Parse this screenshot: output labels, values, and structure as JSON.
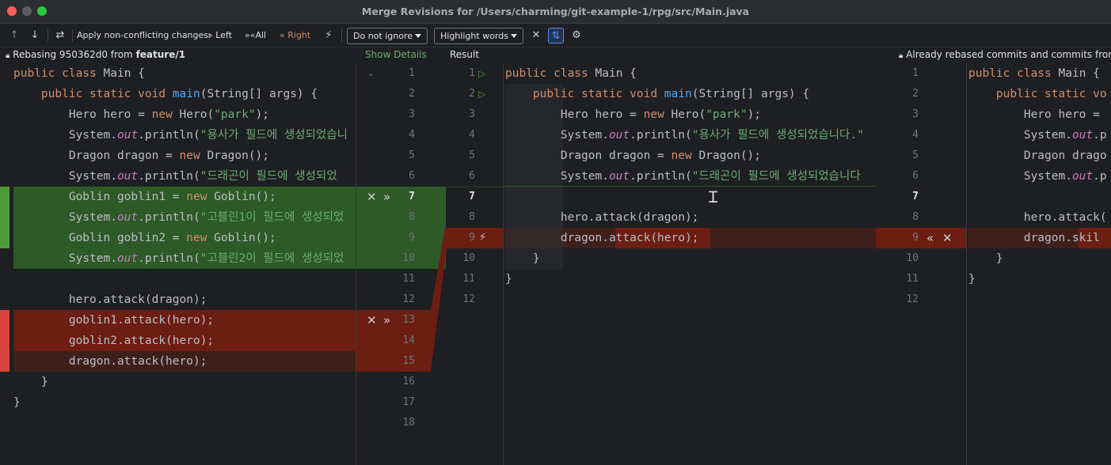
{
  "window": {
    "title": "Merge Revisions for /Users/charming/git-example-1/rpg/src/Main.java"
  },
  "toolbar": {
    "apply_label": "Apply non-conflicting changes:",
    "left_label": "Left",
    "all_label": "All",
    "right_label": "Right",
    "ignore_dropdown": "Do not ignore",
    "highlight_dropdown": "Highlight words"
  },
  "header": {
    "left_info": "Rebasing 950362d0 from",
    "left_branch": "feature/1",
    "show_details": "Show Details",
    "result": "Result",
    "right_info": "Already rebased commits and commits from"
  },
  "left_code": [
    "public class Main {",
    "    public static void main(String[] args) {",
    "        Hero hero = new Hero(\"park\");",
    "        System.out.println(\"용사가 필드에 생성되었습니",
    "        Dragon dragon = new Dragon();",
    "        System.out.println(\"드래곤이 필드에 생성되었",
    "        Goblin goblin1 = new Goblin();",
    "        System.out.println(\"고블린1이 필드에 생성되었",
    "        Goblin goblin2 = new Goblin();",
    "        System.out.println(\"고블린2이 필드에 생성되었",
    "",
    "        hero.attack(dragon);",
    "        goblin1.attack(hero);",
    "        goblin2.attack(hero);",
    "        dragon.attack(hero);",
    "    }",
    "}"
  ],
  "gutter_left_numbers": [
    "1",
    "2",
    "3",
    "4",
    "5",
    "6",
    "7",
    "8",
    "9",
    "10",
    "11",
    "12",
    "13",
    "14",
    "15",
    "16",
    "17",
    "18"
  ],
  "gutter_result_numbers": [
    "1",
    "2",
    "3",
    "4",
    "5",
    "6",
    "7",
    "8",
    "9",
    "10",
    "11",
    "12"
  ],
  "result_code": [
    "public class Main {",
    "    public static void main(String[] args) {",
    "        Hero hero = new Hero(\"park\");",
    "        System.out.println(\"용사가 필드에 생성되었습니다.\"",
    "        Dragon dragon = new Dragon();",
    "        System.out.println(\"드래곤이 필드에 생성되었습니다",
    "",
    "        hero.attack(dragon);",
    "        dragon.attack(hero);",
    "    }",
    "}",
    ""
  ],
  "gutter_right_numbers": [
    "1",
    "2",
    "3",
    "4",
    "5",
    "6",
    "7",
    "8",
    "9",
    "10",
    "11",
    "12"
  ],
  "right_code": [
    "public class Main {",
    "    public static vo",
    "        Hero hero = ",
    "        System.out.p",
    "        Dragon drago",
    "        System.out.p",
    "",
    "        hero.attack(",
    "        dragon.skil",
    "    }",
    "}"
  ],
  "colors": {
    "added_green": "#2d5a27",
    "conflict_red": "#6b1e11",
    "accent_blue": "#548af7"
  }
}
